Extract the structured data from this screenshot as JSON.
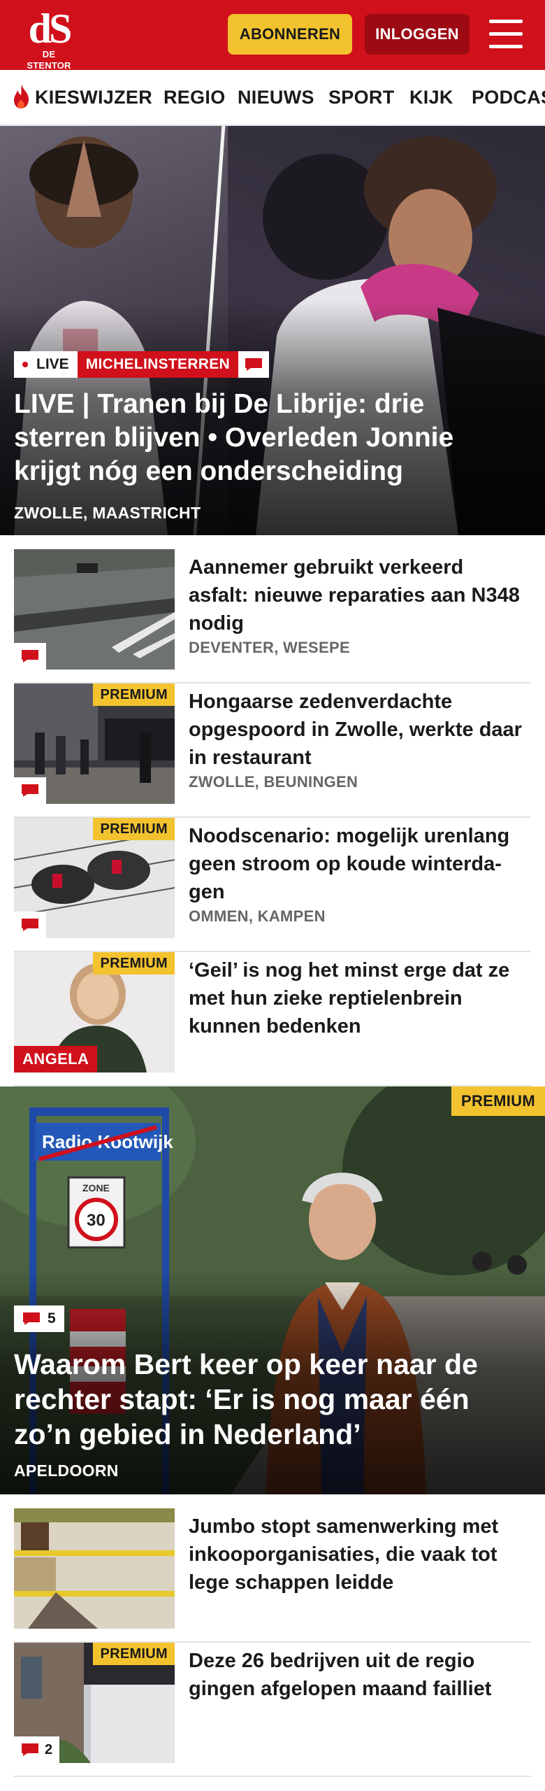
{
  "header": {
    "logo_mark": "dS",
    "logo_text": "DE STENTOR",
    "subscribe_label": "ABONNEREN",
    "login_label": "INLOGGEN",
    "menu_icon": "hamburger-menu-icon",
    "brand_color": "#d0101b",
    "accent_color": "#f3c32f"
  },
  "nav": {
    "items": [
      "KIESWIJZER",
      "REGIO",
      "NIEUWS",
      "SPORT",
      "KIJK",
      "PODCAST"
    ],
    "first_item_icon": "flame-icon"
  },
  "hero": {
    "live_label": "LIVE",
    "category": "MICHELINSTERREN",
    "title": "LIVE | Tranen bij De Librije: drie sterren blijven • Overleden Jonnie krijgt nóg een onderscheiding",
    "location": "ZWOLLE, MAASTRICHT"
  },
  "articles": [
    {
      "title": "Aannemer gebruikt verkeerd asfalt: nieuwe reparaties aan N348 nodig",
      "location": "DEVENTER, WESEPE",
      "premium": "",
      "comments": ""
    },
    {
      "title": "Hongaarse zedenverdachte opgespoord in Zwolle, werkte daar in restaurant",
      "location": "ZWOLLE, BEUNINGEN",
      "premium": "PREMIUM",
      "comments": ""
    },
    {
      "title": "Noodscenario: mogelijk urenlang geen stroom op koude winterda­gen",
      "location": "OMMEN, KAMPEN",
      "premium": "PREMIUM",
      "comments": ""
    },
    {
      "title": "‘Geil’ is nog het minst erge dat ze met hun zieke reptielenbrein kunnen bedenken",
      "location": "",
      "premium": "PREMIUM",
      "author": "ANGELA"
    }
  ],
  "feature": {
    "premium": "PREMIUM",
    "comments": "5",
    "title": "Waarom Bert keer op keer naar de rechter stapt: ‘Er is nog maar één zo’n gebied in Nederland’",
    "location": "APELDOORN",
    "sign_text": "Radio Kootwijk",
    "zone_text": "ZONE",
    "zone_speed": "30"
  },
  "articles2": [
    {
      "title": "Jumbo stopt samenwerking met inkooporganisaties, die vaak tot lege schappen leidde",
      "premium": "",
      "comments": ""
    },
    {
      "title": "Deze 26 bedrijven uit de regio gingen afgelopen maand failliet",
      "premium": "PREMIUM",
      "comments": "2"
    }
  ]
}
